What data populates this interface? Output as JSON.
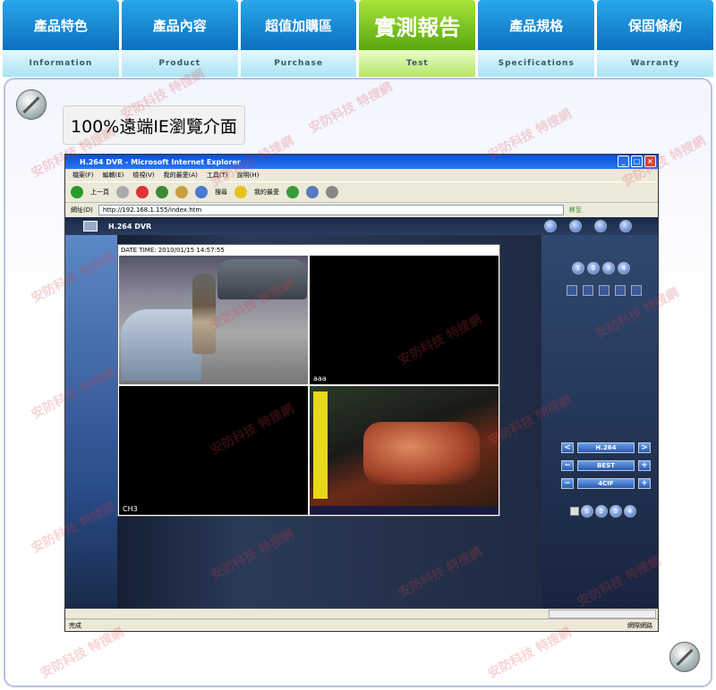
{
  "nav": {
    "tabs": [
      {
        "label": "產品特色",
        "sub": "Information",
        "active": false
      },
      {
        "label": "產品內容",
        "sub": "Product",
        "active": false
      },
      {
        "label": "超值加購區",
        "sub": "Purchase",
        "active": false
      },
      {
        "label": "實測報告",
        "sub": "Test",
        "active": true
      },
      {
        "label": "產品規格",
        "sub": "Specifications",
        "active": false
      },
      {
        "label": "保固條約",
        "sub": "Warranty",
        "active": false
      }
    ]
  },
  "caption": "100%遠端IE瀏覽介面",
  "ie": {
    "title": "H.264 DVR - Microsoft Internet Explorer",
    "menu": [
      "檔案(F)",
      "編輯(E)",
      "檢視(V)",
      "我的最愛(A)",
      "工具(T)",
      "說明(H)"
    ],
    "toolbar": {
      "back": "上一頁",
      "search": "搜尋",
      "favorites": "我的最愛"
    },
    "address_label": "網址(D)",
    "url": "http://192.168.1.155/index.htm",
    "go": "移至",
    "status_left": "完成",
    "status_zone": "網際網路"
  },
  "dvr": {
    "title": "H.264 DVR",
    "datetime": "DATE TIME: 2010/01/15 14:57:55",
    "cams": {
      "ch2": "aaa",
      "ch3": "CH3"
    },
    "channel_buttons": [
      "1",
      "2",
      "3",
      "4"
    ],
    "codec": "H.264",
    "quality": "BEST",
    "resolution": "4CIF",
    "audio_channels": [
      "1",
      "2",
      "3",
      "4"
    ]
  },
  "watermark": "安防科技 特搜網"
}
